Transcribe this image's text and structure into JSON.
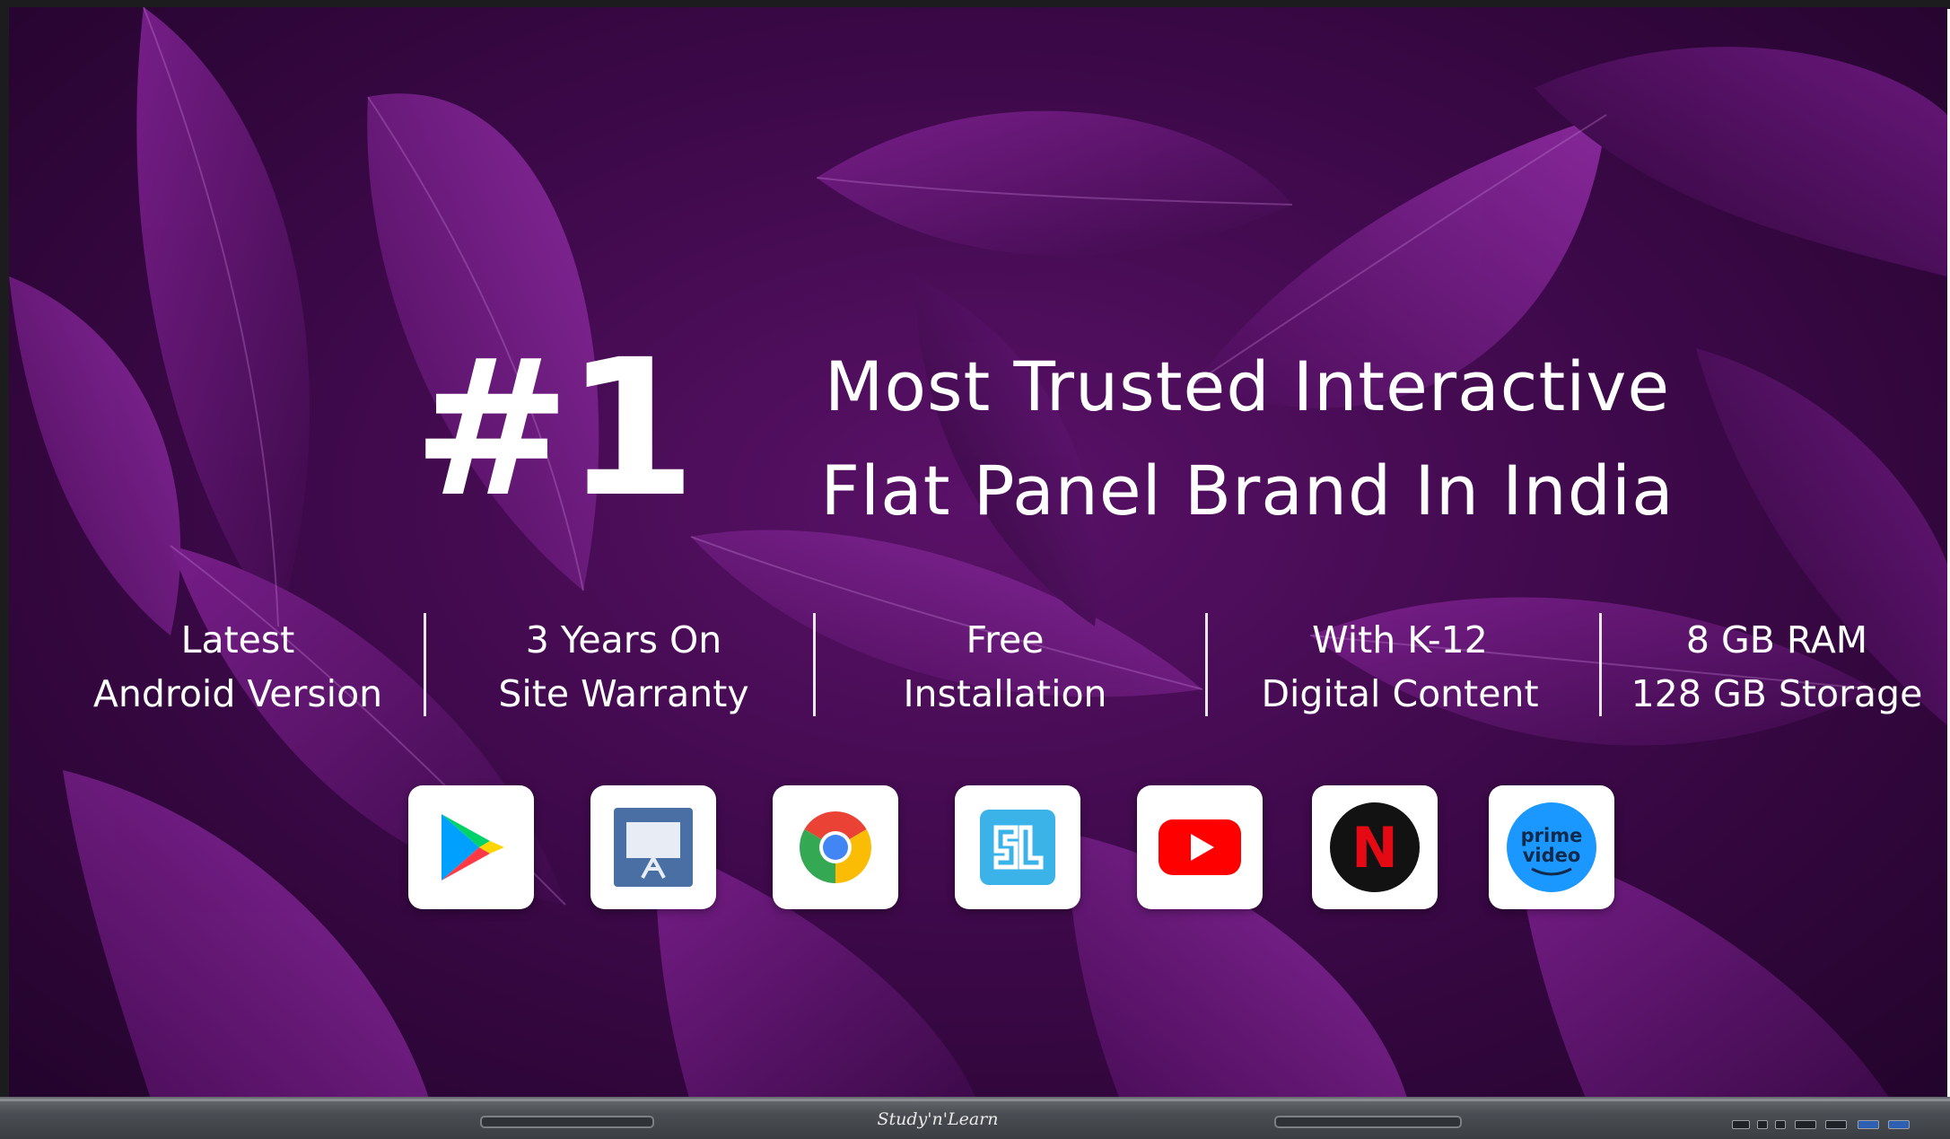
{
  "headline": {
    "rank": "#1",
    "line1": "Most Trusted Interactive",
    "line2": "Flat Panel Brand In India"
  },
  "features": [
    {
      "line1": "Latest",
      "line2": "Android Version"
    },
    {
      "line1": "3 Years On",
      "line2": "Site Warranty"
    },
    {
      "line1": "Free",
      "line2": "Installation"
    },
    {
      "line1": "With K-12",
      "line2": "Digital Content"
    },
    {
      "line1": "8 GB RAM",
      "line2": "128 GB Storage"
    }
  ],
  "apps": [
    {
      "icon": "google-play-icon"
    },
    {
      "icon": "whiteboard-icon"
    },
    {
      "icon": "chrome-icon"
    },
    {
      "icon": "study-n-learn-icon"
    },
    {
      "icon": "youtube-icon"
    },
    {
      "icon": "netflix-icon",
      "letter": "N"
    },
    {
      "icon": "prime-video-icon",
      "label_top": "prime",
      "label_bottom": "video"
    }
  ],
  "bezel": {
    "brand": "Study'n'Learn"
  },
  "colors": {
    "background_purple": "#3a0846",
    "text": "#ffffff",
    "bezel": "#4a4e53"
  }
}
